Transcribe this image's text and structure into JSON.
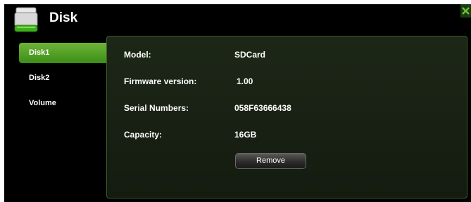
{
  "header": {
    "title": "Disk"
  },
  "sidebar": {
    "items": [
      {
        "label": "Disk1",
        "active": true
      },
      {
        "label": "Disk2",
        "active": false
      },
      {
        "label": "Volume",
        "active": false
      }
    ]
  },
  "details": {
    "model_label": "Model:",
    "model_value": "SDCard",
    "firmware_label": "Firmware version:",
    "firmware_value": "1.00",
    "serial_label": "Serial Numbers:",
    "serial_value": "058F63666438",
    "capacity_label": "Capacity:",
    "capacity_value": "16GB"
  },
  "actions": {
    "remove_label": "Remove"
  },
  "icons": {
    "disk": "hard-disk-icon",
    "close": "close-icon"
  },
  "colors": {
    "accent": "#4fa322",
    "background": "#000000",
    "panel_border": "#3d5b28"
  }
}
